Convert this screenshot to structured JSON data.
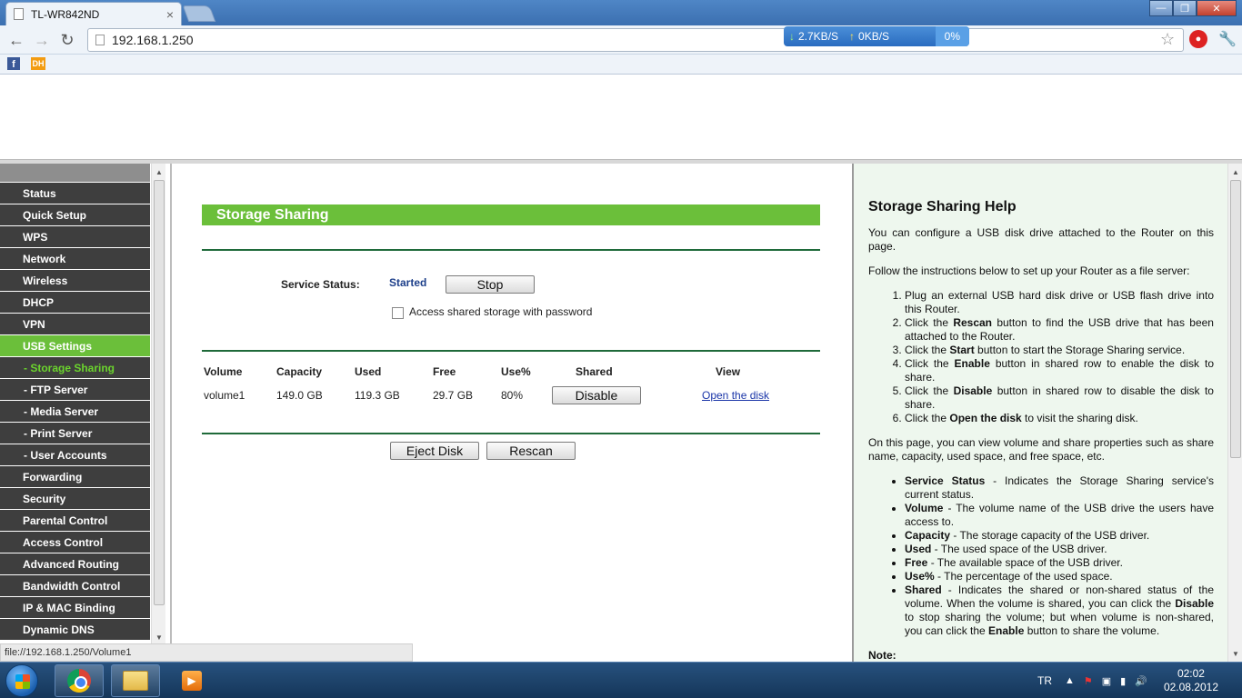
{
  "browser": {
    "tab_title": "TL-WR842ND",
    "tab_close": "×",
    "url": "192.168.1.250",
    "speed": {
      "down": "2.7KB/S",
      "up": "0KB/S",
      "percent": "0%"
    }
  },
  "bookmarks": {
    "facebook": "f",
    "dh": "DH"
  },
  "menu": {
    "items": [
      {
        "label": "Status"
      },
      {
        "label": "Quick Setup"
      },
      {
        "label": "WPS"
      },
      {
        "label": "Network"
      },
      {
        "label": "Wireless"
      },
      {
        "label": "DHCP"
      },
      {
        "label": "VPN"
      },
      {
        "label": "USB Settings"
      },
      {
        "label": "- Storage Sharing"
      },
      {
        "label": "- FTP Server"
      },
      {
        "label": "- Media Server"
      },
      {
        "label": "- Print Server"
      },
      {
        "label": "- User Accounts"
      },
      {
        "label": "Forwarding"
      },
      {
        "label": "Security"
      },
      {
        "label": "Parental Control"
      },
      {
        "label": "Access Control"
      },
      {
        "label": "Advanced Routing"
      },
      {
        "label": "Bandwidth Control"
      },
      {
        "label": "IP & MAC Binding"
      },
      {
        "label": "Dynamic DNS"
      }
    ]
  },
  "main": {
    "title": "Storage Sharing",
    "service_status_label": "Service Status:",
    "service_status_value": "Started",
    "stop_button": "Stop",
    "password_checkbox_label": "Access shared storage with password",
    "table": {
      "headers": [
        "Volume",
        "Capacity",
        "Used",
        "Free",
        "Use%",
        "Shared",
        "View"
      ],
      "row": {
        "volume": "volume1",
        "capacity": "149.0 GB",
        "used": "119.3 GB",
        "free": "29.7 GB",
        "use_pct": "80%",
        "shared_button": "Disable",
        "view_link": "Open the disk"
      }
    },
    "eject_button": "Eject Disk",
    "rescan_button": "Rescan"
  },
  "help": {
    "title": "Storage Sharing Help",
    "intro": "You can configure a USB disk drive attached to the Router on this page.",
    "follow": "Follow the instructions below to set up your Router as a file server:",
    "steps": [
      {
        "pre": "Plug an external USB hard disk drive or USB flash drive into this Router.",
        "b": "",
        "post": ""
      },
      {
        "pre": "Click the ",
        "b": "Rescan",
        "post": " button to find the USB drive that has been attached to the Router."
      },
      {
        "pre": "Click the ",
        "b": "Start",
        "post": " button to start the Storage Sharing service."
      },
      {
        "pre": "Click the ",
        "b": "Enable",
        "post": " button in shared row to enable the disk to share."
      },
      {
        "pre": "Click the ",
        "b": "Disable",
        "post": " button in shared row to disable the disk to share."
      },
      {
        "pre": "Click the ",
        "b": "Open the disk",
        "post": " to visit the sharing disk."
      }
    ],
    "view_text": "On this page, you can view volume and share properties such as share name, capacity, used space, and free space, etc.",
    "terms": [
      {
        "b": "Service Status",
        "post": " - Indicates the Storage Sharing service's current status."
      },
      {
        "b": "Volume",
        "post": " - The volume name of the USB drive the users have access to."
      },
      {
        "b": "Capacity",
        "post": " - The storage capacity of the USB driver."
      },
      {
        "b": "Used",
        "post": " - The used space of the USB driver."
      },
      {
        "b": "Free",
        "post": " - The available space of the USB driver."
      },
      {
        "b": "Use%",
        "post": " - The percentage of the used space."
      }
    ],
    "shared_term": {
      "b": "Shared",
      "t1": " - Indicates the shared or non-shared status of the volume. When the volume is shared, you can click the ",
      "b2": "Disable",
      "t2": " to stop sharing the volume; but when volume is non-shared, you can click the ",
      "b3": "Enable",
      "t3": " button to share the volume."
    },
    "note": "Note:"
  },
  "status_url": "file://192.168.1.250/Volume1",
  "taskbar": {
    "lang": "TR",
    "time": "02:02",
    "date": "02.08.2012"
  }
}
